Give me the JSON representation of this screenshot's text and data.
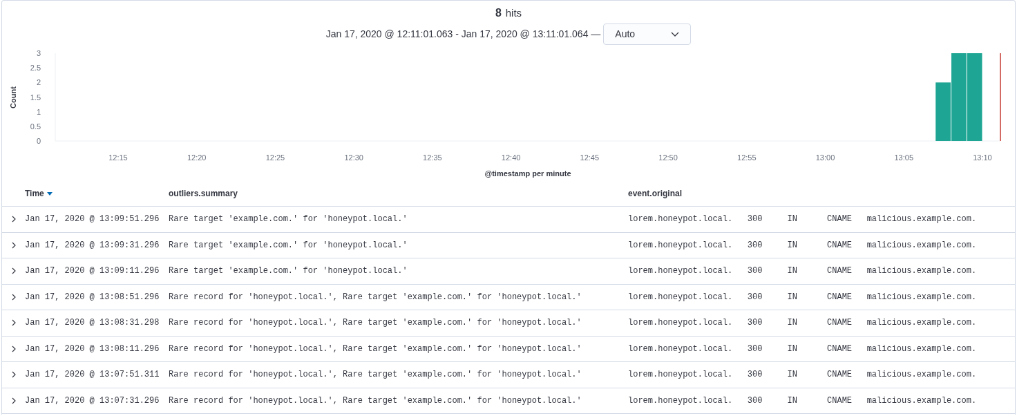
{
  "summary": {
    "count": "8",
    "unit": "hits",
    "range": "Jan 17, 2020 @ 12:11:01.063 - Jan 17, 2020 @ 13:11:01.064 —",
    "interval": "Auto"
  },
  "histogram": {
    "chart_data": {
      "type": "bar",
      "xlabel": "@timestamp per minute",
      "ylabel": "Count",
      "categories": [
        null,
        null,
        null,
        null,
        "12:15",
        null,
        null,
        null,
        null,
        "12:20",
        null,
        null,
        null,
        null,
        "12:25",
        null,
        null,
        null,
        null,
        "12:30",
        null,
        null,
        null,
        null,
        "12:35",
        null,
        null,
        null,
        null,
        "12:40",
        null,
        null,
        null,
        null,
        "12:45",
        null,
        null,
        null,
        null,
        "12:50",
        null,
        null,
        null,
        null,
        "12:55",
        null,
        null,
        null,
        null,
        "13:00",
        null,
        null,
        null,
        null,
        "13:05",
        null,
        null,
        null,
        null,
        "13:10"
      ],
      "values": [
        null,
        null,
        null,
        null,
        null,
        null,
        null,
        null,
        null,
        null,
        null,
        null,
        null,
        null,
        null,
        null,
        null,
        null,
        null,
        null,
        null,
        null,
        null,
        null,
        null,
        null,
        null,
        null,
        null,
        null,
        null,
        null,
        null,
        null,
        null,
        null,
        null,
        null,
        null,
        null,
        null,
        null,
        null,
        null,
        null,
        null,
        null,
        null,
        null,
        null,
        null,
        null,
        null,
        null,
        null,
        null,
        2,
        3,
        3,
        null
      ],
      "ylim": [
        0,
        3
      ],
      "yticks": [
        0,
        0.5,
        1,
        1.5,
        2,
        2.5,
        3
      ]
    }
  },
  "table": {
    "columns": [
      "Time",
      "outliers.summary",
      "event.original"
    ],
    "rows": [
      {
        "time": "Jan 17, 2020 @ 13:09:51.296",
        "summary": "Rare target 'example.com.' for 'honeypot.local.'",
        "event": "lorem.honeypot.local.\t300\tIN\tCNAME\tmalicious.example.com."
      },
      {
        "time": "Jan 17, 2020 @ 13:09:31.296",
        "summary": "Rare target 'example.com.' for 'honeypot.local.'",
        "event": "lorem.honeypot.local.\t300\tIN\tCNAME\tmalicious.example.com."
      },
      {
        "time": "Jan 17, 2020 @ 13:09:11.296",
        "summary": "Rare target 'example.com.' for 'honeypot.local.'",
        "event": "lorem.honeypot.local.\t300\tIN\tCNAME\tmalicious.example.com."
      },
      {
        "time": "Jan 17, 2020 @ 13:08:51.296",
        "summary": "Rare record for 'honeypot.local.', Rare target 'example.com.' for 'honeypot.local.'",
        "event": "lorem.honeypot.local.\t300\tIN\tCNAME\tmalicious.example.com."
      },
      {
        "time": "Jan 17, 2020 @ 13:08:31.298",
        "summary": "Rare record for 'honeypot.local.', Rare target 'example.com.' for 'honeypot.local.'",
        "event": "lorem.honeypot.local.\t300\tIN\tCNAME\tmalicious.example.com."
      },
      {
        "time": "Jan 17, 2020 @ 13:08:11.296",
        "summary": "Rare record for 'honeypot.local.', Rare target 'example.com.' for 'honeypot.local.'",
        "event": "lorem.honeypot.local.\t300\tIN\tCNAME\tmalicious.example.com."
      },
      {
        "time": "Jan 17, 2020 @ 13:07:51.311",
        "summary": "Rare record for 'honeypot.local.', Rare target 'example.com.' for 'honeypot.local.'",
        "event": "lorem.honeypot.local.\t300\tIN\tCNAME\tmalicious.example.com."
      },
      {
        "time": "Jan 17, 2020 @ 13:07:31.296",
        "summary": "Rare record for 'honeypot.local.', Rare target 'example.com.' for 'honeypot.local.'",
        "event": "lorem.honeypot.local.\t300\tIN\tCNAME\tmalicious.example.com."
      }
    ]
  }
}
